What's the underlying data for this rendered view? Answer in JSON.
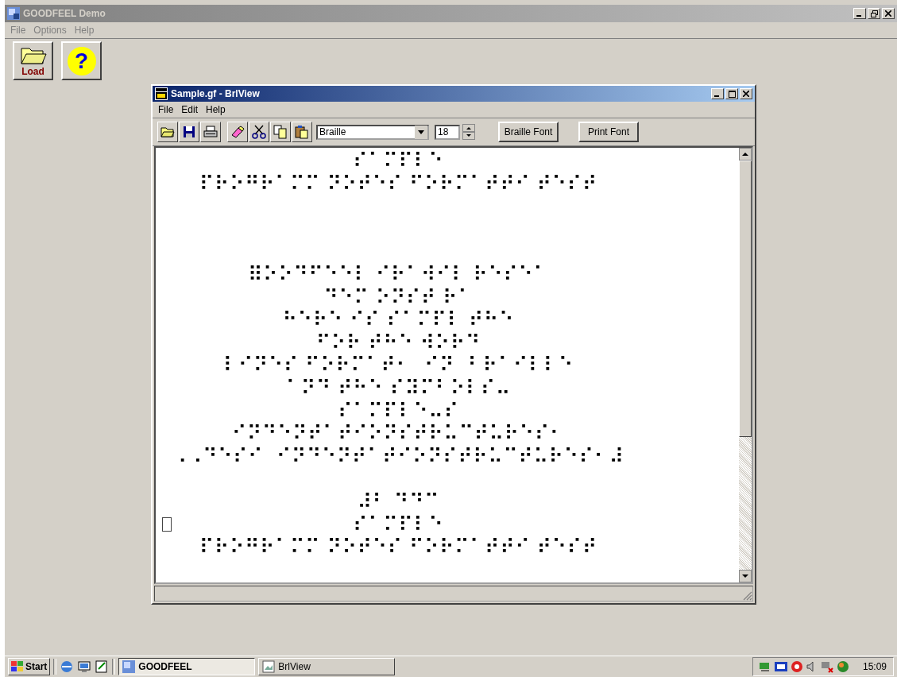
{
  "app": {
    "title": "GOODFEEL Demo",
    "menu": [
      {
        "label": "File",
        "disabled": true
      },
      {
        "label": "Options",
        "disabled": true
      },
      {
        "label": "Help",
        "disabled": true
      }
    ],
    "toolbar": [
      {
        "kind": "load",
        "label": "Load"
      },
      {
        "kind": "help",
        "symbol": "?"
      }
    ]
  },
  "document": {
    "title": "Sample.gf - BrlView",
    "menu": [
      "File",
      "Edit",
      "Help"
    ],
    "toolbar": [
      {
        "kind": "open"
      },
      {
        "kind": "save"
      },
      {
        "kind": "print"
      },
      {
        "kind": "eraser"
      },
      {
        "kind": "cut"
      },
      {
        "kind": "copy"
      },
      {
        "kind": "paste"
      }
    ],
    "font_select": "Braille",
    "size": "18",
    "buttons": [
      "Braille Font",
      "Print Font"
    ],
    "lines": [
      {
        "kind": "text",
        "text": "⠎⠁⠍⠏⠇⠑",
        "cursor": false
      },
      {
        "kind": "text",
        "text": "⠏⠗⠕⠛⠗⠁⠍⠍ ⠝⠕⠞⠑⠎ ⠋⠕⠗⠍⠁⠞⠞⠊ ⠞⠑⠎⠞",
        "cursor": false
      },
      {
        "kind": "blank"
      },
      {
        "kind": "blank"
      },
      {
        "kind": "blank"
      },
      {
        "kind": "text",
        "text": "⠿⠕⠕⠙⠋⠑⠑⠇ ⠊⠗⠁⠺⠊⠇ ⠗⠑⠎⠑⠁",
        "cursor": false
      },
      {
        "kind": "text",
        "text": "⠙⠑⠍ ⠕⠝⠎⠞ ⠗⠁",
        "cursor": false
      },
      {
        "kind": "text",
        "text": "⠓⠑⠗⠑ ⠊⠎ ⠎⠁⠍⠏⠇ ⠞⠓⠑",
        "cursor": false
      },
      {
        "kind": "text",
        "text": "⠋⠕⠗ ⠞⠓⠑ ⠺⠕⠗⠙",
        "cursor": false
      },
      {
        "kind": "text",
        "text": "⠇⠊⠝⠑⠎ ⠋⠕⠗⠍⠁⠞⠂  ⠊⠝  ⠃⠗⠁⠊⠇⠇⠑",
        "cursor": false
      },
      {
        "kind": "text",
        "text": "⠁⠝⠙ ⠞⠓⠑ ⠎⠽⠍⠃⠕⠇⠎⠤",
        "cursor": false
      },
      {
        "kind": "text",
        "text": "⠎⠁⠍⠏⠇⠑⠤⠎",
        "cursor": false
      },
      {
        "kind": "text",
        "text": "⠊⠝⠙⠑⠝⠞⠁⠞⠊⠕⠝⠎⠞⠗⠥⠉⠞⠥⠗⠑⠎⠂",
        "cursor": false
      },
      {
        "kind": "text",
        "text": "⠠⠠⠙⠑⠎⠊  ⠊⠝⠙⠑⠝⠞⠁⠞⠊⠕⠝⠎⠞⠗⠥⠉⠞⠥⠗⠑⠎⠂⠼",
        "cursor": false
      },
      {
        "kind": "blank"
      },
      {
        "kind": "text",
        "text": "⠼⠃ ⠙⠙⠉",
        "cursor": false
      },
      {
        "kind": "text",
        "text": "⠎⠁⠍⠏⠇⠑",
        "cursor": true
      },
      {
        "kind": "text",
        "text": "⠏⠗⠕⠛⠗⠁⠍⠍ ⠝⠕⠞⠑⠎ ⠋⠕⠗⠍⠁⠞⠞⠊ ⠞⠑⠎⠞",
        "cursor": false
      }
    ]
  },
  "taskbar": {
    "start": "Start",
    "tasks": [
      {
        "label": "GOODFEEL",
        "selected": true
      },
      {
        "label": "BrlView",
        "selected": false
      }
    ],
    "clock": "15:09"
  }
}
